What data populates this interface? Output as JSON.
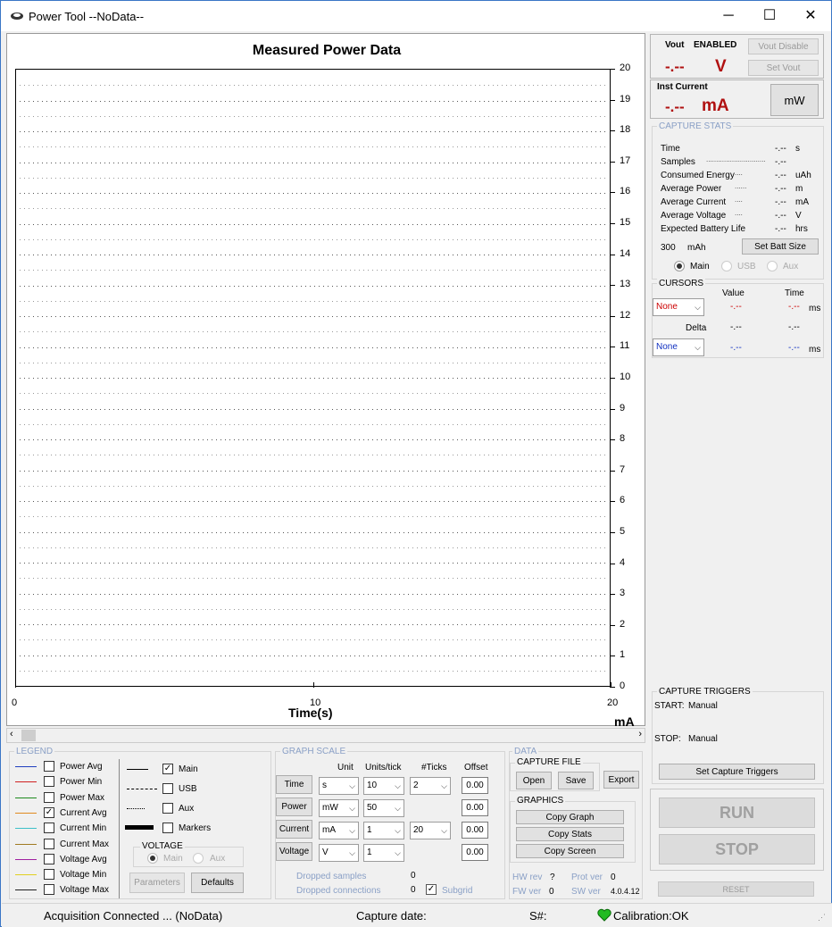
{
  "window": {
    "title": "Power Tool --NoData--",
    "minimize": "─",
    "maximize": "☐",
    "close": "✕"
  },
  "graph": {
    "title": "Measured Power Data",
    "xlabel": "Time(s)",
    "yunit": "mA",
    "yticks": [
      "20",
      "19",
      "18",
      "17",
      "16",
      "15",
      "14",
      "13",
      "12",
      "11",
      "10",
      "9",
      "8",
      "7",
      "6",
      "5",
      "4",
      "3",
      "2",
      "1",
      "0"
    ],
    "xticks": [
      "0",
      "10",
      "20"
    ]
  },
  "vout": {
    "label": "Vout",
    "state": "ENABLED",
    "value": "-.--",
    "unit": "V",
    "disable_btn": "Vout Disable",
    "set_btn": "Set Vout"
  },
  "inst": {
    "label": "Inst Current",
    "value": "-.--",
    "unit": "mA",
    "mw_btn": "mW"
  },
  "stats": {
    "label": "CAPTURE STATS",
    "rows": [
      {
        "name": "Time",
        "dots": "",
        "value": "-.--",
        "unit": "s"
      },
      {
        "name": "Samples",
        "dots": "..............................",
        "value": "-.--",
        "unit": ""
      },
      {
        "name": "Consumed Energy",
        "dots": "....",
        "value": "-.--",
        "unit": "uAh"
      },
      {
        "name": "Average Power",
        "dots": "......",
        "value": "-.--",
        "unit": "m"
      },
      {
        "name": "Average Current",
        "dots": "....",
        "value": "-.--",
        "unit": "mA"
      },
      {
        "name": "Average Voltage",
        "dots": "....",
        "value": "-.--",
        "unit": "V"
      },
      {
        "name": "Expected Battery Life",
        "dots": "",
        "value": "-.--",
        "unit": "hrs"
      }
    ],
    "batt_value": "300",
    "batt_unit": "mAh",
    "set_batt_btn": "Set Batt Size",
    "radio_main": "Main",
    "radio_usb": "USB",
    "radio_aux": "Aux"
  },
  "cursors": {
    "label": "CURSORS",
    "value_hdr": "Value",
    "time_hdr": "Time",
    "delta": "Delta",
    "c1": "None",
    "c1_value": "-.--",
    "c1_time": "-.--",
    "c1_unit": "ms",
    "d_value": "-.--",
    "d_time": "-.--",
    "c2": "None",
    "c2_value": "-.--",
    "c2_time": "-.--",
    "c2_unit": "ms"
  },
  "triggers": {
    "label": "CAPTURE TRIGGERS",
    "start_lbl": "START:",
    "start_val": "Manual",
    "stop_lbl": "STOP:",
    "stop_val": "Manual",
    "set_btn": "Set Capture Triggers"
  },
  "run": {
    "run": "RUN",
    "stop": "STOP",
    "reset": "RESET"
  },
  "legend": {
    "label": "LEGEND",
    "items": [
      {
        "name": "Power Avg",
        "color": "#1f3fbf",
        "checked": false
      },
      {
        "name": "Power Min",
        "color": "#d02020",
        "checked": false
      },
      {
        "name": "Power Max",
        "color": "#1e8a1e",
        "checked": false
      },
      {
        "name": "Current Avg",
        "color": "#e08a20",
        "checked": true
      },
      {
        "name": "Current Min",
        "color": "#3cc0c8",
        "checked": false
      },
      {
        "name": "Current Max",
        "color": "#a07a20",
        "checked": false
      },
      {
        "name": "Voltage Avg",
        "color": "#a020a0",
        "checked": false
      },
      {
        "name": "Voltage Min",
        "color": "#e0d020",
        "checked": false
      },
      {
        "name": "Voltage Max",
        "color": "#202020",
        "checked": false
      }
    ],
    "main": "Main",
    "usb": "USB",
    "aux": "Aux",
    "markers": "Markers",
    "voltage_label": "VOLTAGE",
    "v_main": "Main",
    "v_aux": "Aux",
    "params_btn": "Parameters",
    "defaults_btn": "Defaults"
  },
  "scale": {
    "label": "GRAPH SCALE",
    "h_unit": "Unit",
    "h_units": "Units/tick",
    "h_ticks": "#Ticks",
    "h_offset": "Offset",
    "rows": [
      {
        "name": "Time",
        "unit": "s",
        "units": "10",
        "ticks": "2",
        "offset": "0.00"
      },
      {
        "name": "Power",
        "unit": "mW",
        "units": "50",
        "ticks": "",
        "offset": "0.00"
      },
      {
        "name": "Current",
        "unit": "mA",
        "units": "1",
        "ticks": "20",
        "offset": "0.00"
      },
      {
        "name": "Voltage",
        "unit": "V",
        "units": "1",
        "ticks": "",
        "offset": "0.00"
      }
    ],
    "dropped_samples": "Dropped samples",
    "dropped_samples_val": "0",
    "dropped_conn": "Dropped connections",
    "dropped_conn_val": "0",
    "subgrid": "Subgrid"
  },
  "data": {
    "label": "DATA",
    "capture_file": "CAPTURE FILE",
    "open": "Open",
    "save": "Save",
    "export": "Export",
    "graphics": "GRAPHICS",
    "copy_graph": "Copy Graph",
    "copy_stats": "Copy Stats",
    "copy_screen": "Copy Screen",
    "hw_rev": "HW rev",
    "hw_rev_val": "?",
    "prot_ver": "Prot ver",
    "prot_ver_val": "0",
    "fw_ver": "FW ver",
    "fw_ver_val": "0",
    "sw_ver": "SW ver",
    "sw_ver_val": "4.0.4.12"
  },
  "status": {
    "acq": "Acquisition Connected ... (NoData)",
    "capture": "Capture date:",
    "sn": "S#:",
    "calib": "Calibration:OK"
  }
}
